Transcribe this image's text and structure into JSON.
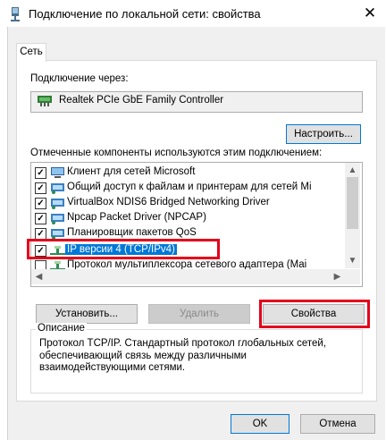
{
  "window": {
    "title": "Подключение по локальной сети: свойства",
    "close_glyph": "✕"
  },
  "tabs": [
    {
      "label": "Сеть"
    }
  ],
  "connect_via": {
    "label": "Подключение через:",
    "adapter": "Realtek PCIe GbE Family Controller",
    "configure_button": "Настроить..."
  },
  "components": {
    "label": "Отмеченные компоненты используются этим подключением:",
    "items": [
      {
        "label": "Клиент для сетей Microsoft",
        "checked": true,
        "icon": "network-client-icon"
      },
      {
        "label": "Общий доступ к файлам и принтерам для сетей Mi",
        "checked": true,
        "icon": "service-icon"
      },
      {
        "label": "VirtualBox NDIS6 Bridged Networking Driver",
        "checked": true,
        "icon": "service-icon"
      },
      {
        "label": "Npcap Packet Driver (NPCAP)",
        "checked": true,
        "icon": "service-icon"
      },
      {
        "label": "Планировщик пакетов QoS",
        "checked": true,
        "icon": "service-icon"
      },
      {
        "label": "IP версии 4 (TCP/IPv4)",
        "checked": true,
        "icon": "protocol-icon",
        "selected": true
      },
      {
        "label": "Протокол мультиплексора сетевого адаптера (Mai",
        "checked": false,
        "icon": "protocol-icon"
      }
    ]
  },
  "buttons": {
    "install": "Установить...",
    "remove": "Удалить",
    "properties": "Свойства",
    "ok": "OK",
    "cancel": "Отмена"
  },
  "description": {
    "title": "Описание",
    "text": "Протокол TCP/IP. Стандартный протокол глобальных сетей, обеспечивающий связь между различными взаимодействующими сетями."
  },
  "colors": {
    "highlight": "#e3001b",
    "selection": "#0078d7"
  }
}
